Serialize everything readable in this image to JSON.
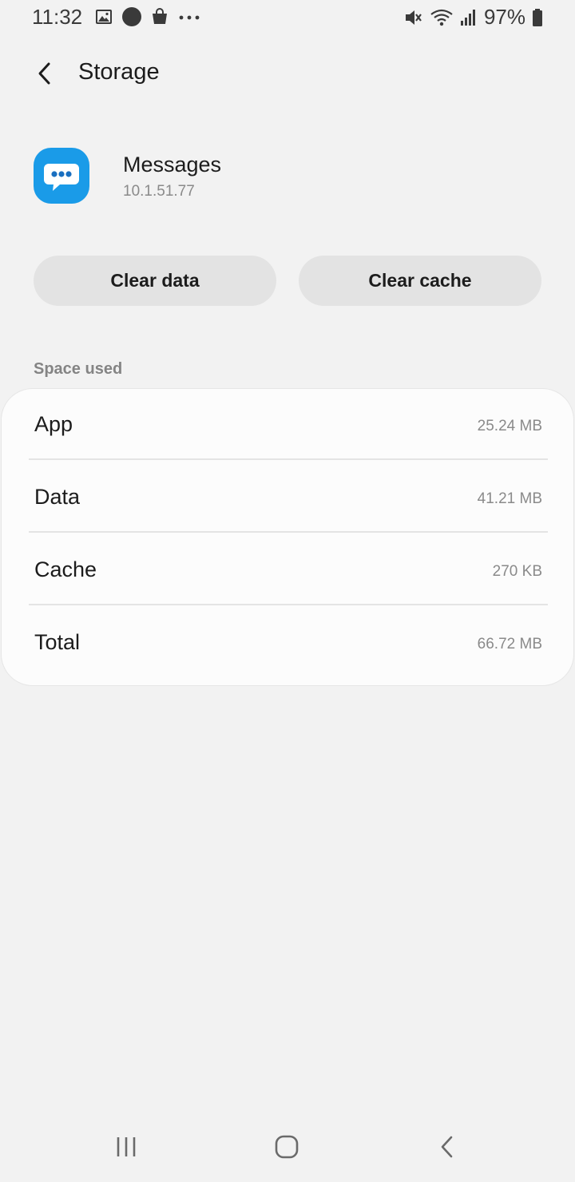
{
  "status_bar": {
    "time": "11:32",
    "battery_percent": "97%",
    "icons_left": [
      "gallery-icon",
      "notification-dot-icon",
      "shopping-bag-icon",
      "more-dots-icon"
    ],
    "icons_right": [
      "mute-icon",
      "wifi-icon",
      "signal-icon",
      "battery-icon"
    ]
  },
  "header": {
    "title": "Storage"
  },
  "app": {
    "name": "Messages",
    "version": "10.1.51.77",
    "icon_color": "#1a9be8"
  },
  "actions": {
    "clear_data_label": "Clear data",
    "clear_cache_label": "Clear cache"
  },
  "space_used": {
    "section_title": "Space used",
    "rows": [
      {
        "label": "App",
        "value": "25.24 MB"
      },
      {
        "label": "Data",
        "value": "41.21 MB"
      },
      {
        "label": "Cache",
        "value": "270 KB"
      },
      {
        "label": "Total",
        "value": "66.72 MB"
      }
    ]
  },
  "nav_bar": {
    "buttons": [
      "recent-apps-icon",
      "home-icon",
      "back-icon"
    ]
  }
}
